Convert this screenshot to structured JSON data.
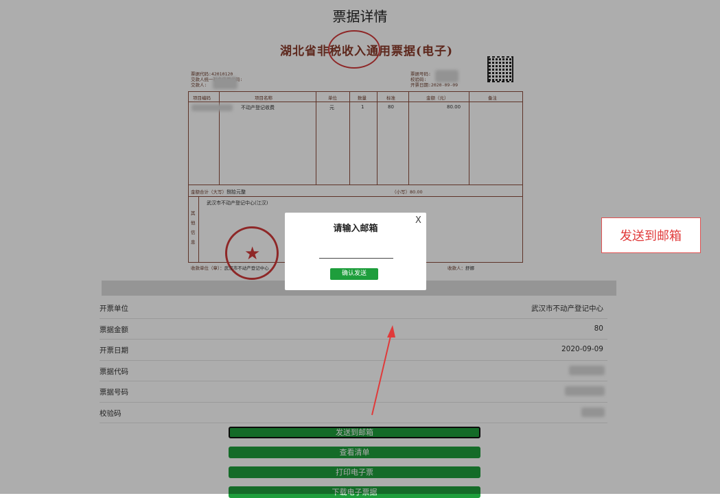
{
  "page": {
    "title": "票据详情"
  },
  "receipt": {
    "title": "湖北省非税收入通用票据(电子)",
    "code_label": "票据代码:",
    "code": "42010120",
    "payer_label_1": "交款人统一社会信用代码:",
    "payer_label_2": "交款人:",
    "number_label": "票据号码:",
    "check_label": "校验码:",
    "date_label": "开票日期:",
    "date": "2020-09-09",
    "headers": [
      "项目编码",
      "项目名称",
      "单位",
      "数量",
      "标准",
      "金额（元）",
      "备注"
    ],
    "item": {
      "name": "不动产登记收费",
      "unit": "元",
      "qty": "1",
      "std": "80",
      "amount": "80.00"
    },
    "total_label": "金额合计（大写）",
    "total_words": "捌拾元整",
    "total_small_label": "（小写）",
    "total_small": "80.00",
    "other_label": "其他信息",
    "other_text": "武汉市不动产登记中心(江汉)",
    "collector_label": "收款单位（章）：",
    "collector": "武汉市不动产登记中心",
    "recipient_label": "收款人：",
    "recipient": "舒娜"
  },
  "info": {
    "rows": [
      {
        "label": "开票单位",
        "value": "武汉市不动产登记中心"
      },
      {
        "label": "票据金额",
        "value": "80"
      },
      {
        "label": "开票日期",
        "value": "2020-09-09"
      },
      {
        "label": "票据代码",
        "value": ""
      },
      {
        "label": "票据号码",
        "value": ""
      },
      {
        "label": "校验码",
        "value": ""
      }
    ]
  },
  "buttons": {
    "send_email": "发送到邮箱",
    "view_list": "查看清单",
    "print": "打印电子票",
    "download": "下载电子票据"
  },
  "modal": {
    "title": "请输入邮箱",
    "close": "X",
    "email_value": "",
    "confirm": "确认发送"
  },
  "annotation": {
    "label": "发送到邮箱"
  },
  "colors": {
    "accent_green": "#1e9e3c",
    "annotation_red": "#e03a3a",
    "seal_red": "#d23a3a"
  }
}
